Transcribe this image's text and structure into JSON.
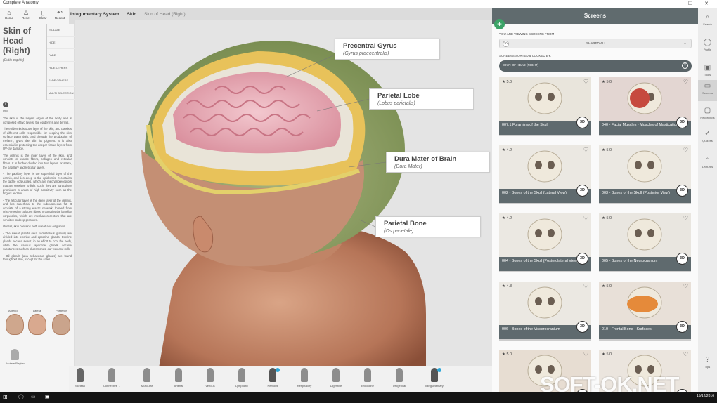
{
  "app_title": "Complete Anatomy",
  "toolbar": [
    {
      "label": "Home",
      "icon": "home-icon",
      "glyph": "⌂"
    },
    {
      "label": "Reset",
      "icon": "reset-figure-icon",
      "glyph": "♙"
    },
    {
      "label": "Clear",
      "icon": "clear-icon",
      "glyph": "▯"
    },
    {
      "label": "Recent",
      "icon": "recent-icon",
      "glyph": "↶"
    }
  ],
  "breadcrumb": [
    "Integumentary System",
    "Skin",
    "Skin of Head (Right)"
  ],
  "left": {
    "title": "Skin of Head (Right)",
    "latin": "(Cutis capitis)",
    "menu": [
      "ISOLATE",
      "HIDE",
      "FADE",
      "HIDE OTHERS",
      "FADE OTHERS",
      "MULTI SELECTION"
    ],
    "info_label": "Info",
    "paragraphs": [
      "The skin is the largest organ of the body and is composed of two layers, the epidermis and dermis.",
      "The epidermis is outer layer of the skin, and consists of different cells responsible for keeping the skin surface water tight, and through the production of melanin, gives the skin its pigment. It is also essential in protecting the deeper tissue layers from UV-ray damage.",
      "The dermis is the inner layer of the skin, and consists of elastic fibers, collagen and reticular fibers. It is further divided into two layers, or strata, the papillary and reticular layers.",
      "- The papillary layer is the superficial layer of the dermis, and lies deep to the epidermis. It contains the tactile corpuscles, which are mechanoreceptors that are sensitive to light touch, they are particularly prominent in areas of high sensitivity such as the fingers and lips.",
      "- The reticular layer is the deep layer of the dermis, and lies superficial to the subcutaneous fat. It consists of a strong elastic network, formed from criss-crossing collagen fibers. It contains the lamellar corpuscles, which are mechanoreceptors that are sensitive to deep pressure.",
      "Overall, skin contains both sweat and oil glands.",
      "- The sweat glands (aka sudoriferous glands) are divided into eccrine and apocrine glands. Eccrine glands secrete sweat, in an effort to cool the body, while the various apocrine glands secrete substances such as pheromones, ear wax and milk.",
      "- Oil glands (aka sebaceous glands) are found throughout skin, except for the soles"
    ],
    "views": [
      "Anterior",
      "Lateral",
      "Posterior"
    ],
    "isolate_region": "Isolate Region"
  },
  "callouts": [
    {
      "name": "Precentral Gyrus",
      "latin": "(Gyrus praecentralis)"
    },
    {
      "name": "Parietal Lobe",
      "latin": "(Lobus parietalis)"
    },
    {
      "name": "Dura Mater of Brain",
      "latin": "(Dura Mater)"
    },
    {
      "name": "Parietal Bone",
      "latin": "(Os parietale)"
    }
  ],
  "systems": [
    "Skeletal",
    "Connective T.",
    "Muscular",
    "Arterial",
    "Venous",
    "Lymphatic",
    "Nervous",
    "Respiratory",
    "Digestive",
    "Endocrine",
    "Urogenital",
    "Integumentary"
  ],
  "screens": {
    "title": "Screens",
    "viewing_label": "YOU ARE VIEWING SCREENS FROM",
    "source": "SHARED/ALL",
    "sorted_label": "SCREENS SORTED & LOCKED BY:",
    "sorted_by": "SKIN OF HEAD (RIGHT)",
    "cards": [
      {
        "rating": "★ 5.0",
        "title": "007.1 Foramina of the Skull"
      },
      {
        "rating": "★ 5.0",
        "title": "040 - Facial Muscles - Muscles of Mastication"
      },
      {
        "rating": "★ 4.2",
        "title": "002 - Bones of the Skull (Lateral View)"
      },
      {
        "rating": "★ 5.0",
        "title": "003 - Bones of the Skull (Posterior View)"
      },
      {
        "rating": "★ 4.2",
        "title": "004 - Bones of the Skull (Posterolateral View)"
      },
      {
        "rating": "★ 5.0",
        "title": "005 - Bones of the Neurocranium"
      },
      {
        "rating": "★ 4.8",
        "title": "006 - Bones of the Viscerocranium"
      },
      {
        "rating": "★ 5.0",
        "title": "010 - Frontal Bone - Surfaces"
      },
      {
        "rating": "★ 5.0",
        "title": ""
      },
      {
        "rating": "★ 5.0",
        "title": ""
      }
    ],
    "btn_3d": "3D"
  },
  "rail": [
    {
      "label": "Search",
      "glyph": "⌕"
    },
    {
      "label": "Profile",
      "glyph": "◯"
    },
    {
      "label": "Tools",
      "glyph": "▣"
    },
    {
      "label": "Screens",
      "glyph": "▭"
    },
    {
      "label": "Recordings",
      "glyph": "▢"
    },
    {
      "label": "Quizzes",
      "glyph": "✓"
    },
    {
      "label": "Lectures",
      "glyph": "⌂"
    },
    {
      "label": "Tips",
      "glyph": "?"
    }
  ],
  "taskbar_date": "15/12/2016",
  "watermark": "SOFT-OK.NET"
}
